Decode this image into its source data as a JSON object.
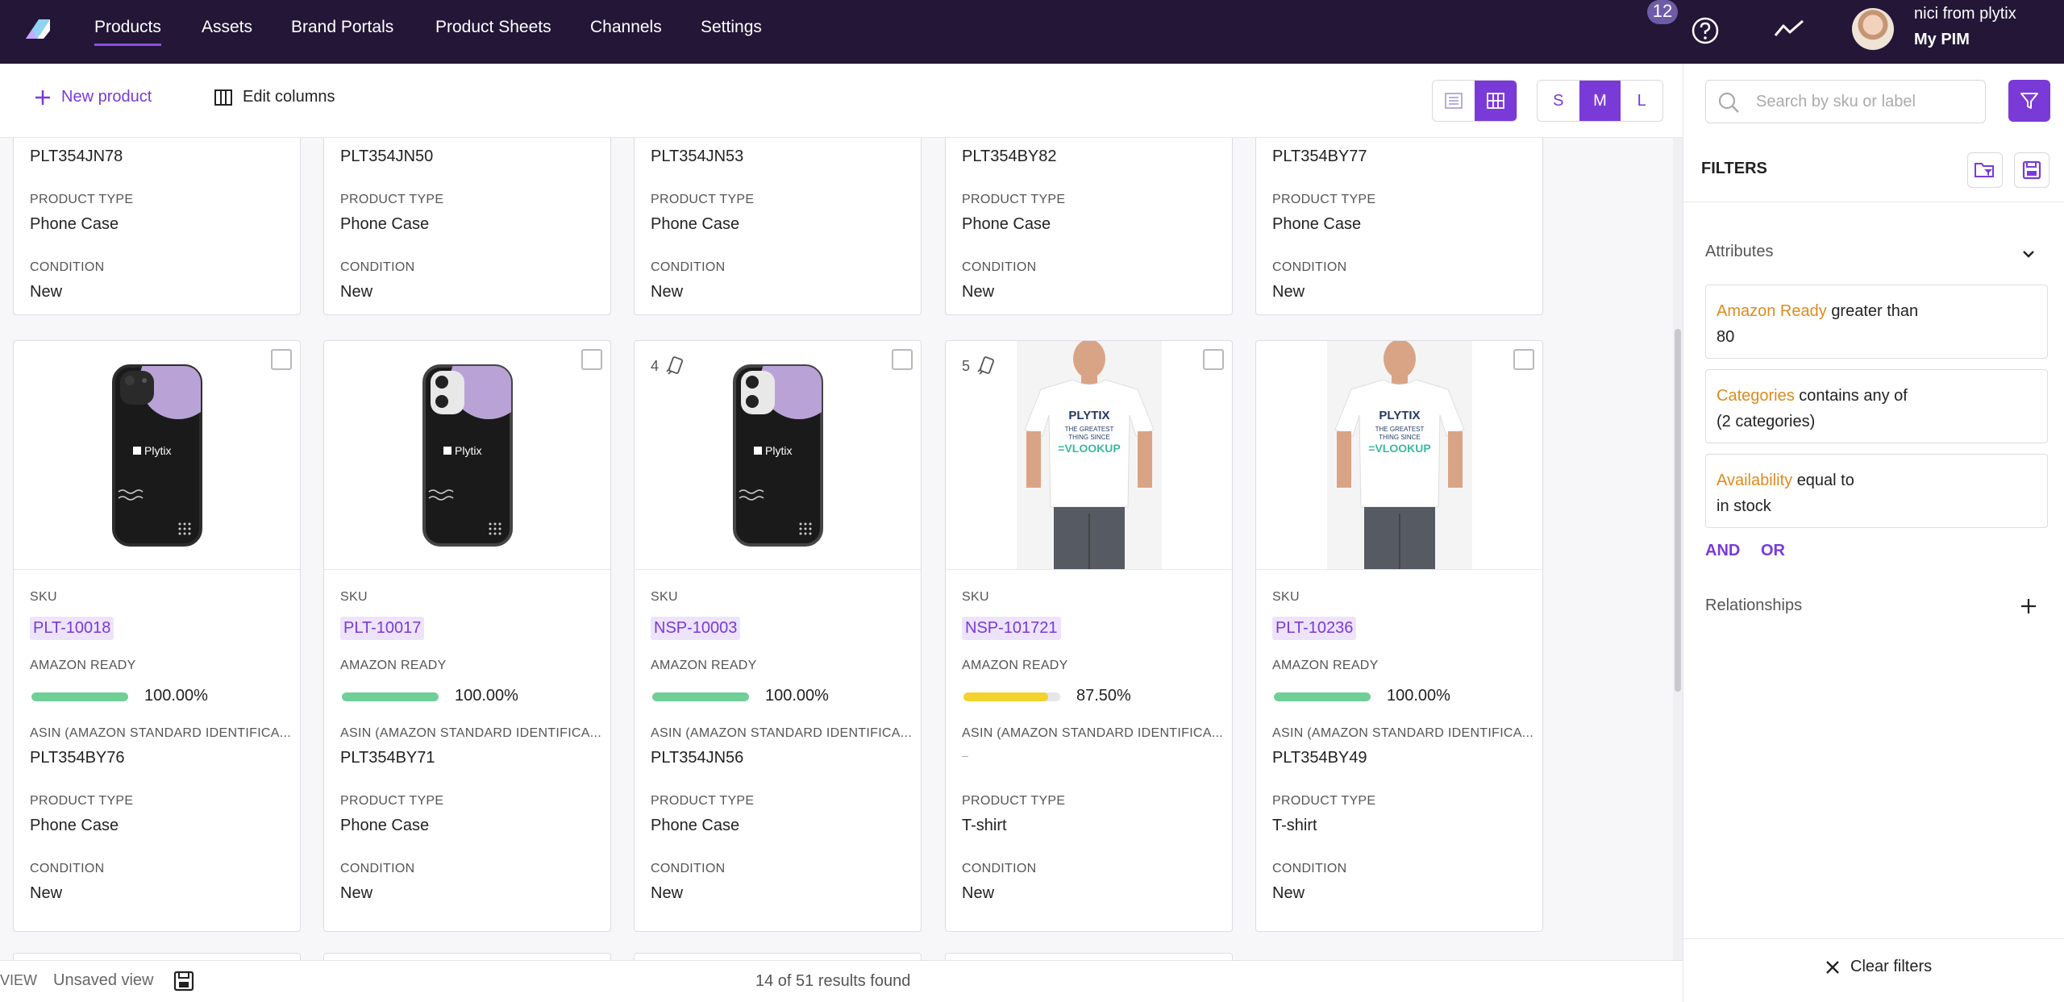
{
  "nav": {
    "items": [
      "Products",
      "Assets",
      "Brand Portals",
      "Product Sheets",
      "Channels",
      "Settings"
    ],
    "notification_count": "12",
    "user_name": "nici from plytix",
    "account_name": "My PIM"
  },
  "toolbar": {
    "new_product": "New product",
    "edit_columns": "Edit columns",
    "sizes": [
      "S",
      "M",
      "L"
    ],
    "selected_size": "M"
  },
  "search": {
    "placeholder": "Search by sku or label"
  },
  "filters": {
    "title": "FILTERS",
    "attributes_label": "Attributes",
    "conditions": [
      {
        "attribute": "Amazon Ready",
        "operator": "greater than",
        "value": "80"
      },
      {
        "attribute": "Categories",
        "operator": "contains any of",
        "value": "(2 categories)"
      },
      {
        "attribute": "Availability",
        "operator": "equal to",
        "value": "in stock"
      }
    ],
    "and_label": "AND",
    "or_label": "OR",
    "relationships_label": "Relationships",
    "clear_label": "Clear filters"
  },
  "labels": {
    "sku": "SKU",
    "amazon_ready": "AMAZON READY",
    "asin": "ASIN (AMAZON STANDARD IDENTIFICA...",
    "product_type": "PRODUCT TYPE",
    "condition": "CONDITION"
  },
  "top_row": [
    {
      "asin": "PLT354JN78",
      "product_type": "Phone Case",
      "condition": "New"
    },
    {
      "asin": "PLT354JN50",
      "product_type": "Phone Case",
      "condition": "New"
    },
    {
      "asin": "PLT354JN53",
      "product_type": "Phone Case",
      "condition": "New"
    },
    {
      "asin": "PLT354BY82",
      "product_type": "Phone Case",
      "condition": "New"
    },
    {
      "asin": "PLT354BY77",
      "product_type": "Phone Case",
      "condition": "New"
    }
  ],
  "cards": [
    {
      "image": "phone-case-black",
      "variants": "",
      "sku": "PLT-10018",
      "amazon_ready": 100,
      "amazon_ready_text": "100.00%",
      "bar_color": "#6fcf97",
      "asin": "PLT354BY76",
      "product_type": "Phone Case",
      "condition": "New"
    },
    {
      "image": "phone-case-black-white-camera",
      "variants": "",
      "sku": "PLT-10017",
      "amazon_ready": 100,
      "amazon_ready_text": "100.00%",
      "bar_color": "#6fcf97",
      "asin": "PLT354BY71",
      "product_type": "Phone Case",
      "condition": "New"
    },
    {
      "image": "phone-case-black-white-camera",
      "variants": "4",
      "sku": "NSP-10003",
      "amazon_ready": 100,
      "amazon_ready_text": "100.00%",
      "bar_color": "#6fcf97",
      "asin": "PLT354JN56",
      "product_type": "Phone Case",
      "condition": "New"
    },
    {
      "image": "tshirt-white",
      "variants": "5",
      "sku": "NSP-101721",
      "amazon_ready": 87.5,
      "amazon_ready_text": "87.50%",
      "bar_color": "#f2d22e",
      "asin": "–",
      "product_type": "T-shirt",
      "condition": "New"
    },
    {
      "image": "tshirt-white",
      "variants": "",
      "sku": "PLT-10236",
      "amazon_ready": 100,
      "amazon_ready_text": "100.00%",
      "bar_color": "#6fcf97",
      "asin": "PLT354BY49",
      "product_type": "T-shirt",
      "condition": "New"
    }
  ],
  "tshirt_text": {
    "brand": "PLYTIX",
    "line1": "THE GREATEST",
    "line2": "THING SINCE",
    "line3": "=VLOOKUP"
  },
  "phone_brand": "Plytix",
  "footer": {
    "view_label": "VIEW",
    "unsaved_view": "Unsaved view",
    "results": "14 of 51 results found"
  },
  "colors": {
    "accent": "#7a3ad8",
    "nav_bg": "#231637",
    "attribute": "#e08b1c",
    "ready_full": "#6fcf97",
    "ready_partial": "#f2d22e"
  }
}
